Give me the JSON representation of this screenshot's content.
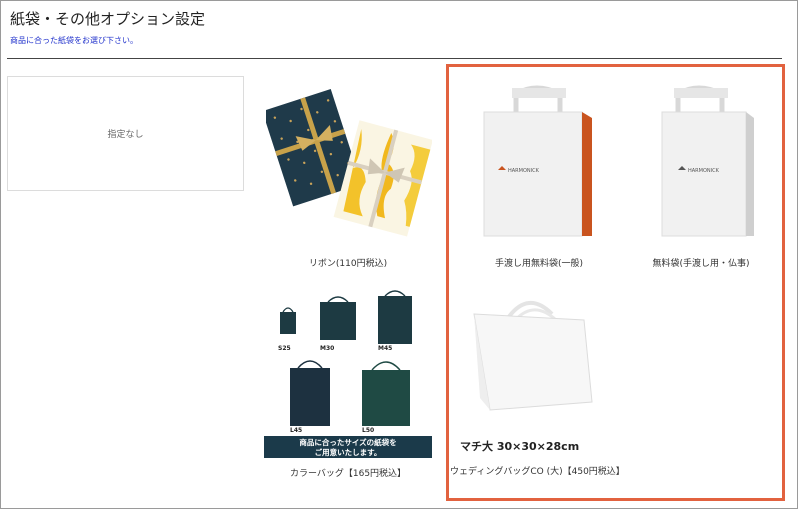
{
  "page": {
    "title": "紙袋・その他オプション設定",
    "subtitle": "商品に合った紙袋をお選び下さい。"
  },
  "options": {
    "none_label": "指定なし",
    "ribbon": "リボン(110円税込)",
    "handbag_general": "手渡し用無料袋(一般)",
    "handbag_memorial": "無料袋(手渡し用・仏事)",
    "color_bag": "カラーバッグ【165円税込】",
    "wedding_bag": "ウェディングバッグCO (大)【450円税込】"
  },
  "images": {
    "brand": "HARMONICK",
    "color_sizes": [
      "S25",
      "M30",
      "M45",
      "L45",
      "L50"
    ],
    "color_banner_line1": "商品に合ったサイズの紙袋を",
    "color_banner_line2": "ご用意いたします。",
    "wedding_size": "マチ大  30×30×28cm"
  },
  "colors": {
    "highlight": "#e2623f",
    "subtitle": "#2233cc",
    "navy": "#1f3a44",
    "orange_gusset": "#c9541f"
  }
}
